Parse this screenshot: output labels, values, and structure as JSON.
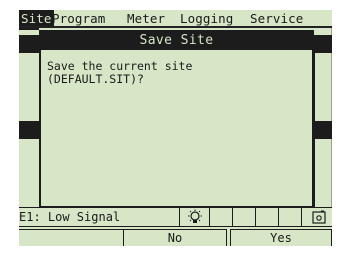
{
  "menubar": {
    "items": [
      {
        "label": "Site",
        "active": true
      },
      {
        "label": "Program",
        "active": false
      },
      {
        "label": "Meter",
        "active": false
      },
      {
        "label": "Logging",
        "active": false
      },
      {
        "label": "Service",
        "active": false
      }
    ]
  },
  "dialog": {
    "title": "Save Site",
    "message": "Save the current site\n(DEFAULT.SIT)?"
  },
  "status": {
    "text": "E1: Low Signal",
    "icons": [
      "lightbulb-icon",
      "document-icon"
    ]
  },
  "softkeys": {
    "left": "",
    "no": "No",
    "yes": "Yes"
  },
  "colors": {
    "lcd_background": "#d6e6c6",
    "lcd_foreground": "#1c1c1c"
  }
}
